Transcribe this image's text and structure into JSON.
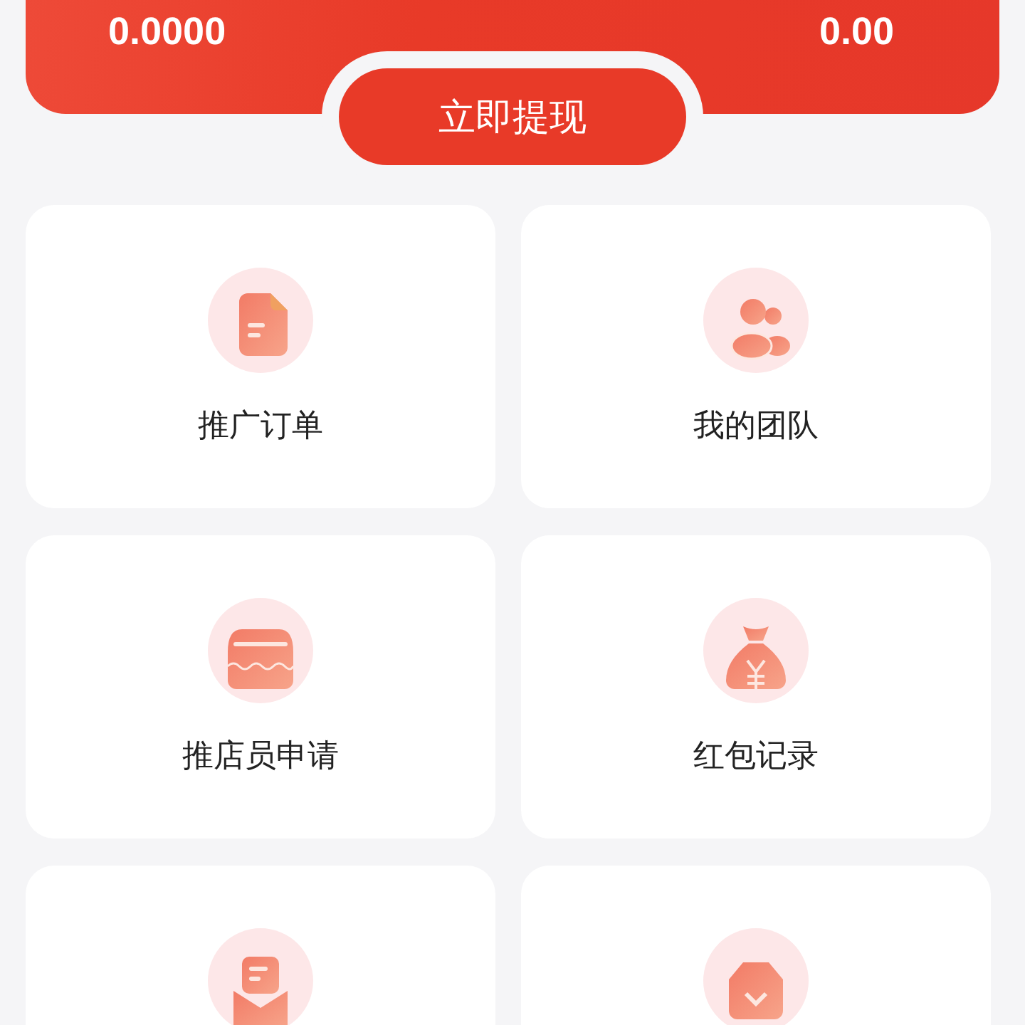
{
  "balance_card": {
    "left_amount": "0.0000",
    "right_amount": "0.00"
  },
  "withdraw_button": {
    "label": "立即提现"
  },
  "menu": [
    {
      "kind": "document",
      "label": "推广订单"
    },
    {
      "kind": "team",
      "label": "我的团队"
    },
    {
      "kind": "store",
      "label": "推店员申请"
    },
    {
      "kind": "moneybag",
      "label": "红包记录"
    },
    {
      "kind": "envelope"
    },
    {
      "kind": "shield"
    }
  ]
}
